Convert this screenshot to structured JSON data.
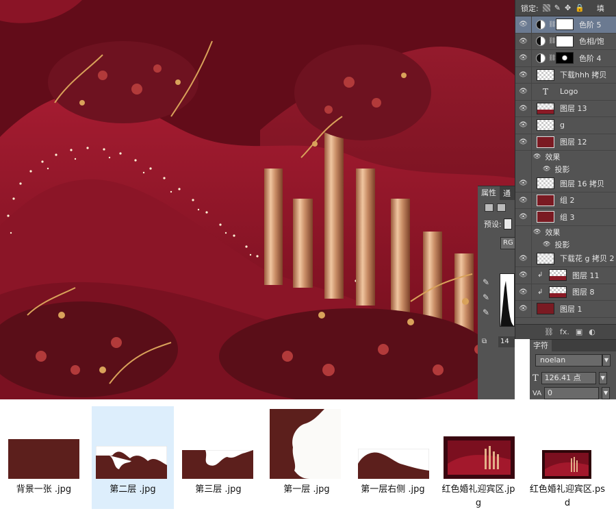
{
  "layers_panel": {
    "lock_label": "锁定:",
    "fill_label": "填",
    "layers": [
      {
        "name": "色阶 5",
        "thumb": "adjustment-mask-white",
        "selected": true
      },
      {
        "name": "色相/饱",
        "thumb": "adjustment-mask-white",
        "selected": false
      },
      {
        "name": "色阶 4",
        "thumb": "adjustment-mask-black",
        "selected": false
      },
      {
        "name": "下载hhh 拷贝",
        "thumb": "checker",
        "selected": false
      },
      {
        "name": "Logo",
        "thumb": "type",
        "selected": false
      },
      {
        "name": "图层 13",
        "thumb": "checker-red",
        "selected": false
      },
      {
        "name": "g",
        "thumb": "checker",
        "selected": false
      },
      {
        "name": "图层 12",
        "thumb": "red-shape",
        "selected": false
      },
      {
        "name": "效果",
        "sub": true
      },
      {
        "name": "投影",
        "sub": true
      },
      {
        "name": "图层 16 拷贝",
        "thumb": "checker",
        "selected": false
      },
      {
        "name": "组 2",
        "thumb": "group",
        "selected": false
      },
      {
        "name": "组 3",
        "thumb": "group",
        "selected": false
      },
      {
        "name": "效果",
        "sub": true
      },
      {
        "name": "投影",
        "sub": true
      },
      {
        "name": "下载花 g 拷贝 2",
        "thumb": "checker",
        "selected": false
      },
      {
        "name": "图层 11",
        "thumb": "checker-red",
        "clipped": true
      },
      {
        "name": "图层 8",
        "thumb": "checker-red",
        "clipped": true
      },
      {
        "name": "图层 1",
        "thumb": "red",
        "selected": false
      }
    ],
    "footer_icons": [
      "link-icon",
      "fx-icon",
      "mask-icon",
      "adjustment-icon"
    ],
    "footer_fx_label": "fx."
  },
  "properties_panel": {
    "tab_label": "属性",
    "tab2_label": "通",
    "preset_label": "预设:",
    "channel_label": "RG",
    "value": "14"
  },
  "character_panel": {
    "tab_label": "字符",
    "font_name": "noelan",
    "font_size": "126.41 点",
    "tracking": "0",
    "size_icon": "T",
    "tracking_icon": "VA"
  },
  "files": [
    {
      "name": "背景一张 .jpg",
      "selected": false,
      "shape": "full"
    },
    {
      "name": "第二层 .jpg",
      "selected": true,
      "shape": "layer2"
    },
    {
      "name": "第三层 .jpg",
      "selected": false,
      "shape": "layer3"
    },
    {
      "name": "第一层 .jpg",
      "selected": false,
      "shape": "layer1"
    },
    {
      "name": "第一层右侧 .jpg",
      "selected": false,
      "shape": "layer1right"
    },
    {
      "name": "红色婚礼迎宾区.jpg",
      "selected": false,
      "shape": "photo"
    },
    {
      "name": "红色婚礼迎宾区.psd",
      "selected": false,
      "shape": "photo-psd"
    }
  ],
  "colors": {
    "wine": "#5c1f1c",
    "crimson": "#8a1428",
    "panel": "#535353",
    "selected_layer": "#6b7a91",
    "selected_file": "#ddeefc",
    "gold": "#d9a25a"
  }
}
